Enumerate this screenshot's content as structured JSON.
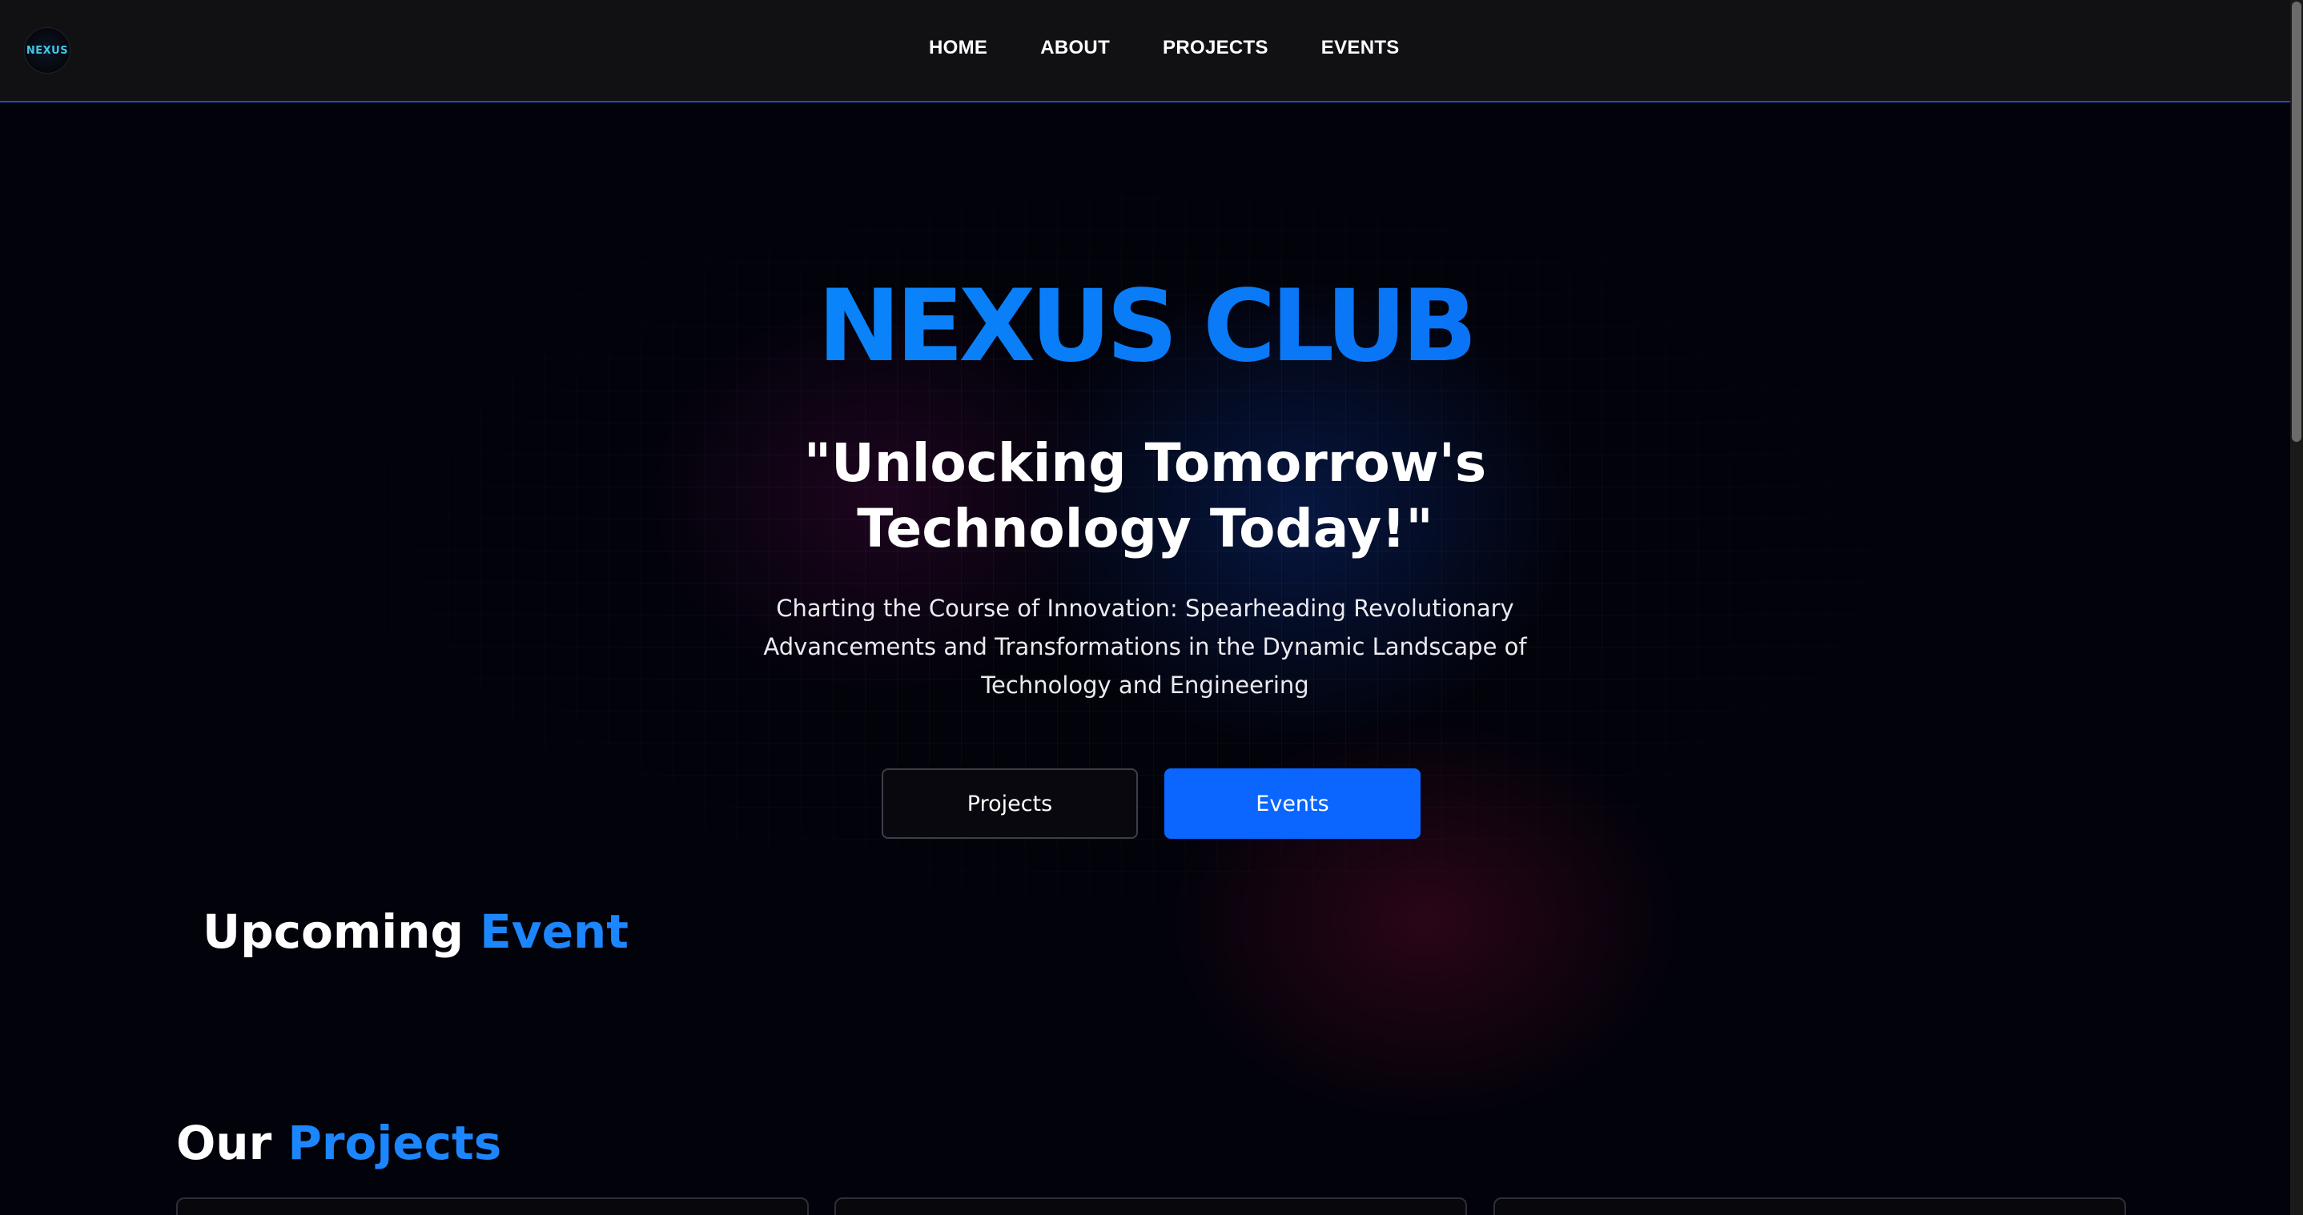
{
  "nav": {
    "logo_text": "NEXUS",
    "links": [
      "HOME",
      "ABOUT",
      "PROJECTS",
      "EVENTS"
    ]
  },
  "hero": {
    "title": "NEXUS CLUB",
    "tagline_line1": "\"Unlocking Tomorrow's",
    "tagline_line2": "Technology Today!\"",
    "description": "Charting the Course of Innovation: Spearheading Revolutionary Advancements and Transformations in the Dynamic Landscape of Technology and Engineering",
    "buttons": {
      "projects": "Projects",
      "events": "Events"
    }
  },
  "upcoming": {
    "heading_plain": "Upcoming ",
    "heading_accent": "Event"
  },
  "projects_section": {
    "heading_plain": "Our ",
    "heading_accent": "Projects"
  },
  "colors": {
    "accent": "#0a66ff",
    "title_gradient_start": "#0a98ff",
    "title_gradient_end": "#0a60f0",
    "nav_background": "#111113",
    "nav_border": "#1b4fbf",
    "page_background": "#02020a"
  }
}
